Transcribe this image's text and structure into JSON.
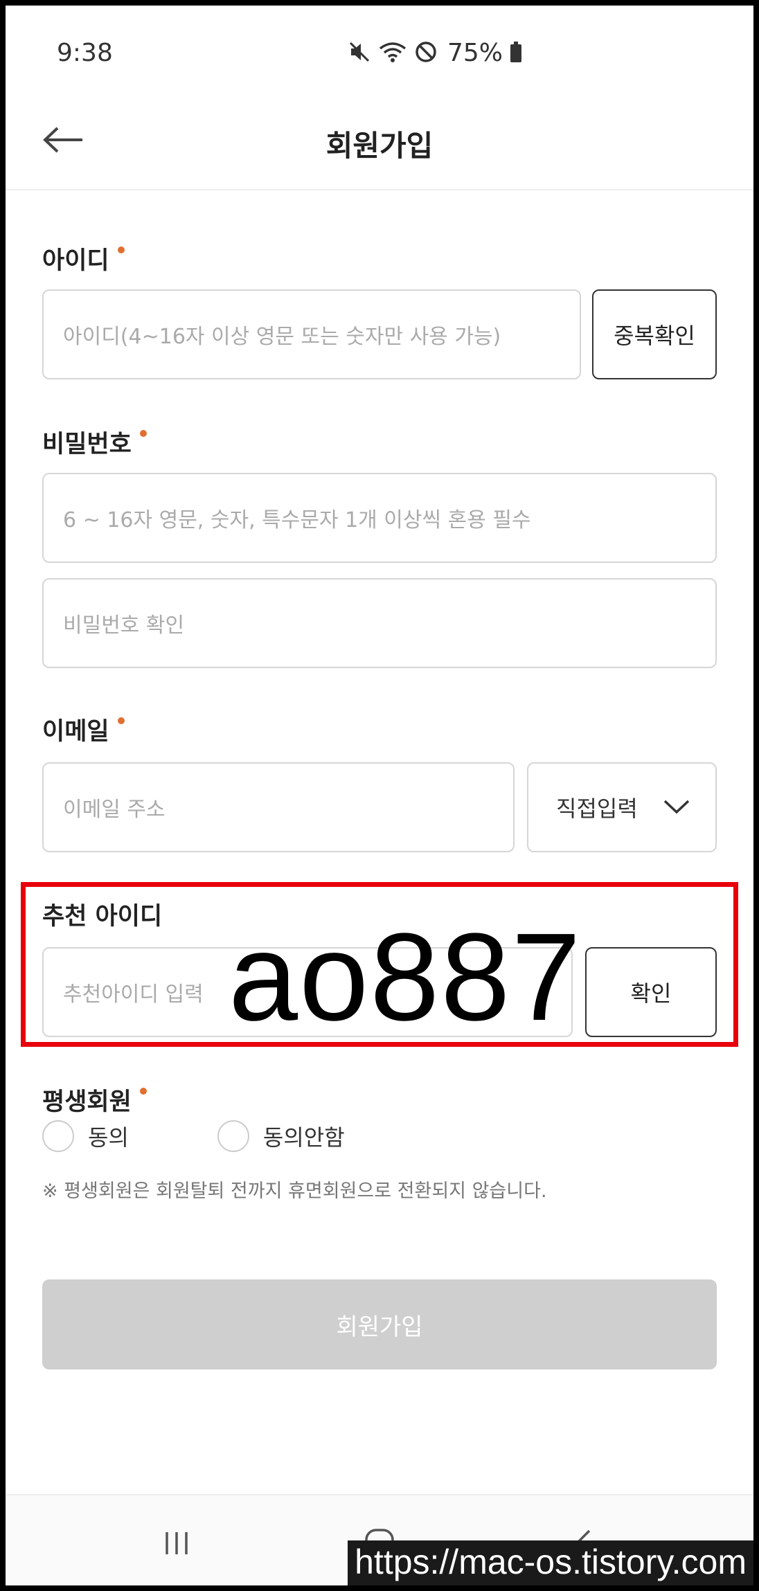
{
  "status_bar": {
    "time": "9:38",
    "battery_percent": "75%",
    "icons": [
      "mute-icon",
      "wifi-icon",
      "do-not-disturb-icon",
      "battery-icon"
    ]
  },
  "header": {
    "title": "회원가입",
    "back_icon": "back-arrow-icon"
  },
  "form": {
    "id": {
      "label": "아이디",
      "placeholder": "아이디(4~16자 이상 영문 또는 숫자만 사용 가능)",
      "check_button": "중복확인"
    },
    "password": {
      "label": "비밀번호",
      "placeholder": "6 ~ 16자 영문, 숫자, 특수문자 1개 이상씩 혼용 필수",
      "confirm_placeholder": "비밀번호 확인"
    },
    "email": {
      "label": "이메일",
      "placeholder": "이메일 주소",
      "domain_select": "직접입력"
    },
    "referral": {
      "label": "추천 아이디",
      "placeholder": "추천아이디 입력",
      "confirm_button": "확인",
      "overlay_text": "ao887"
    },
    "lifetime_member": {
      "label": "평생회원",
      "options": [
        "동의",
        "동의안함"
      ],
      "notice": "※ 평생회원은 회원탈퇴 전까지 휴면회원으로 전환되지 않습니다."
    },
    "submit_label": "회원가입"
  },
  "colors": {
    "required_dot": "#e07030",
    "highlight_border": "#e8000b",
    "submit_disabled": "#cfcfcf"
  },
  "nav_bar": {
    "icons": [
      "recent-apps-icon",
      "home-icon",
      "back-icon"
    ]
  },
  "watermark": "https://mac-os.tistory.com"
}
